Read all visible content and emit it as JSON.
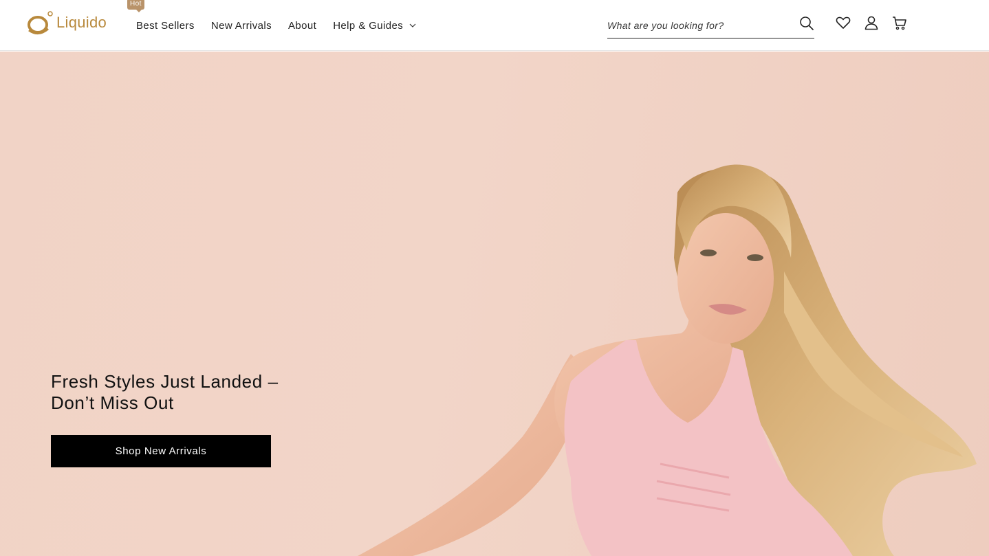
{
  "brand": {
    "name": "Liquido",
    "accent": "#b8893c",
    "badge_color": "#b9936a"
  },
  "nav": {
    "items": [
      {
        "label": "Best Sellers",
        "badge": "Hot"
      },
      {
        "label": "New Arrivals"
      },
      {
        "label": "About"
      },
      {
        "label": "Help & Guides",
        "has_dropdown": true
      }
    ]
  },
  "search": {
    "placeholder": "What are you looking for?",
    "value": ""
  },
  "header_icons": [
    "search-icon",
    "wishlist-heart-icon",
    "account-user-icon",
    "cart-icon"
  ],
  "hero": {
    "title_line1": "Fresh Styles Just Landed –",
    "title_line2": "Don’t Miss Out",
    "cta_label": "Shop New Arrivals",
    "background_color": "#f1d3c6"
  }
}
